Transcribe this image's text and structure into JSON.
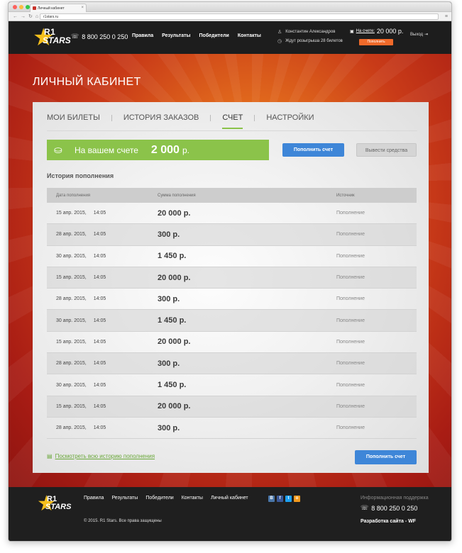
{
  "browser": {
    "tab_title": "Личный кабинет",
    "url": "r1stars.ru"
  },
  "header": {
    "logo_top": "R1",
    "logo_bottom": "STARS",
    "phone": "8 800 250 0 250",
    "nav": [
      "Правила",
      "Результаты",
      "Победители",
      "Контакты"
    ],
    "user_name": "Константин Александров",
    "waiting": "Ждут розыгрыша 28 билетов",
    "balance_label": "На счете:",
    "balance_value": "20 000 р.",
    "topup_label": "Пополнить",
    "logout_label": "Выход"
  },
  "page": {
    "title": "ЛИЧНЫЙ КАБИНЕТ",
    "tabs": [
      "МОИ БИЛЕТЫ",
      "ИСТОРИЯ ЗАКАЗОВ",
      "СЧЕТ",
      "НАСТРОЙКИ"
    ],
    "active_tab": "СЧЕТ",
    "balance_text": "На вашем счете",
    "balance_amount": "2 000",
    "balance_currency": "р.",
    "topup_button": "Пополнить счет",
    "withdraw_button": "Вывести средства",
    "history_title": "История пополнения",
    "columns": [
      "Дата пополнения",
      "Сумма пополнения",
      "Источник"
    ],
    "rows": [
      {
        "date": "15 апр. 2015,",
        "time": "14:05",
        "amount": "20 000 р.",
        "source": "Пополнение"
      },
      {
        "date": "28 апр. 2015,",
        "time": "14:05",
        "amount": "300 р.",
        "source": "Пополнение"
      },
      {
        "date": "30 апр. 2015,",
        "time": "14:05",
        "amount": "1 450 р.",
        "source": "Пополнение"
      },
      {
        "date": "15 апр. 2015,",
        "time": "14:05",
        "amount": "20 000 р.",
        "source": "Пополнение"
      },
      {
        "date": "28 апр. 2015,",
        "time": "14:05",
        "amount": "300 р.",
        "source": "Пополнение"
      },
      {
        "date": "30 апр. 2015,",
        "time": "14:05",
        "amount": "1 450 р.",
        "source": "Пополнение"
      },
      {
        "date": "15 апр. 2015,",
        "time": "14:05",
        "amount": "20 000 р.",
        "source": "Пополнение"
      },
      {
        "date": "28 апр. 2015,",
        "time": "14:05",
        "amount": "300 р.",
        "source": "Пополнение"
      },
      {
        "date": "30 апр. 2015,",
        "time": "14:05",
        "amount": "1 450 р.",
        "source": "Пополнение"
      },
      {
        "date": "15 апр. 2015,",
        "time": "14:05",
        "amount": "20 000 р.",
        "source": "Пополнение"
      },
      {
        "date": "28 апр. 2015,",
        "time": "14:05",
        "amount": "300 р.",
        "source": "Пополнение"
      }
    ],
    "view_all": "Посмотреть всю историю пополнения",
    "bottom_topup_button": "Пополнить счет"
  },
  "footer": {
    "logo_top": "R1",
    "logo_bottom": "STARS",
    "nav": [
      "Правила",
      "Результаты",
      "Победители",
      "Контакты",
      "Личный кабинет"
    ],
    "copyright": "© 2015. R1 Stars. Все права защищены",
    "social": [
      "В",
      "f",
      "t",
      "о"
    ],
    "support_label": "Информационная поддержка",
    "support_phone": "8 800 250 0 250",
    "developer": "Разработка сайта - WF"
  },
  "colors": {
    "accent_green": "#8bc34a",
    "button_blue": "#3e86d8",
    "header_bg": "#1d1d1d",
    "topup_orange": "#f06a2a"
  }
}
